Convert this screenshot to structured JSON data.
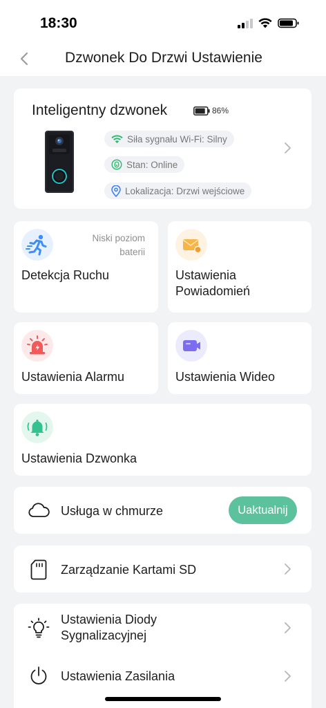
{
  "status_bar": {
    "time": "18:30"
  },
  "header": {
    "title": "Dzwonek Do Drzwi Ustawienie",
    "back_icon": "chevron-left-icon"
  },
  "device": {
    "name": "Inteligentny dzwonek",
    "battery_percent": "86%",
    "battery_level": 0.86,
    "wifi_label": "Siła sygnału Wi-Fi: Silny",
    "status_label": "Stan: Online",
    "location_label": "Lokalizacja: Drzwi wejściowe"
  },
  "tiles": {
    "motion": {
      "title": "Detekcja Ruchu",
      "note_line1": "Niski poziom",
      "note_line2": "baterii",
      "icon": "running-person-icon"
    },
    "notifications": {
      "title_line1": "Ustawienia",
      "title_line2": "Powiadomień",
      "icon": "envelope-icon"
    },
    "alarm": {
      "title": "Ustawienia Alarmu",
      "icon": "siren-icon"
    },
    "video": {
      "title": "Ustawienia Wideo",
      "icon": "video-camera-icon"
    },
    "chime": {
      "title": "Ustawienia Dzwonka",
      "icon": "bell-icon"
    }
  },
  "cloud": {
    "label": "Usługa w chmurze",
    "button": "Uaktualnij",
    "icon": "cloud-icon"
  },
  "sd": {
    "label": "Zarządzanie Kartami SD",
    "icon": "sd-card-icon"
  },
  "led": {
    "label_line1": "Ustawienia Diody",
    "label_line2": "Sygnalizacyjnej",
    "icon": "light-bulb-icon"
  },
  "power": {
    "label": "Ustawienia Zasilania",
    "icon": "power-icon"
  },
  "colors": {
    "accent_green": "#5cc29e",
    "background": "#f2f3f5",
    "card": "#ffffff",
    "motion_blue": "#3e8ef7",
    "notify_orange": "#f7b547",
    "alarm_red": "#f25a5a",
    "video_purple": "#7b6cf0",
    "chime_green": "#34c38f"
  }
}
